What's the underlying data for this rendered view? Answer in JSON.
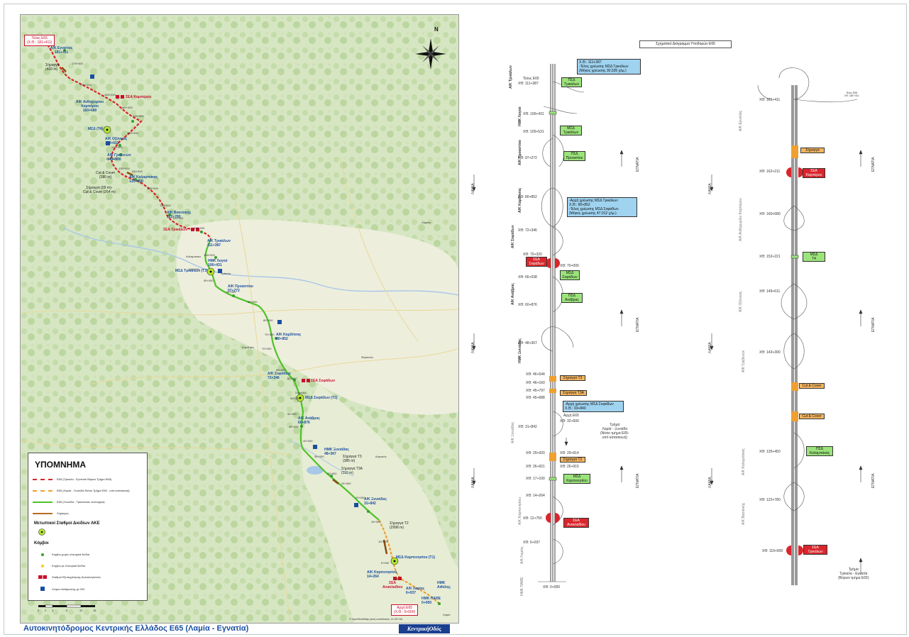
{
  "title": "Αυτοκινητόδρομος Κεντρικής Ελλάδος Ε65 (Λαμία - Εγνατία)",
  "logo_text": "ΚεντρικήΟδός",
  "colors": {
    "accent": "#1a4fa0",
    "brand_red": "#c8102e",
    "route_green": "#4fc22a",
    "route_red": "#d9262c",
    "route_orange": "#f0a030"
  },
  "map": {
    "north_label": "N",
    "attribution": "© OpenStreetMap (and) contributors, CC-BY-SA",
    "scale_labels": [
      "0",
      "2",
      "4",
      "8",
      "12",
      "16"
    ],
    "start_box": [
      "Τέλος Ε65",
      "(Χ.Θ.: 181+411)"
    ],
    "end_box": [
      "Αρχή Ε65",
      "(Χ.Θ.: 0+000)"
    ],
    "labels": {
      "ak_egnatias": [
        "Α/Κ Εγνατίας",
        "181+411"
      ],
      "tunnel_400": [
        "Σήραγγα",
        "(400 m)"
      ],
      "sea_karpirou": "ΣΕΑ Καρπέρου",
      "ak_anthochoriou": [
        "Α/Κ Ανθοχωρίου",
        "Καρπέρου",
        "160+680"
      ],
      "msd_t4": "ΜΣΔ (Τ4)",
      "ak_oxyneias": [
        "Α/Κ Οξύνειας",
        "149+611"
      ],
      "ak_grevenon": [
        "Α/Κ Γρεβενών",
        "143+390"
      ],
      "cut_cover_180": [
        "Cut & Cover",
        "(180 m)"
      ],
      "ak_kalampakas": [
        "Α/Κ Καλαμπάκας",
        "135+450"
      ],
      "tunnel_65": [
        "Σήραγγα (65 m)-",
        "Cut & Cover (264 m)"
      ],
      "ak_vasilikis": [
        "Α/Κ Βασιλικής",
        "122+780"
      ],
      "sea_trikalon": "ΣΕΑ Τρικάλων",
      "ak_trikalon": [
        "Α/Κ Τρικάλων",
        "111+387"
      ],
      "ihk_lygou": [
        "ΗΜΚ Λυγού",
        "106+431"
      ],
      "msd_trikalon": "ΜΣΔ Τρικάλων (Τ3)",
      "ak_prodromou": [
        "Α/Κ Προαστίου",
        "97+272"
      ],
      "ak_karditsas": [
        "Α/Κ Καρδίτσας",
        "80+852"
      ],
      "ak_sofadon": [
        "Α/Κ Σοφάδων",
        "72+346"
      ],
      "sea_sofadon": "ΣΕΑ Σοφάδων",
      "msd_sofadon": "ΜΣΔ Σοφάδων (Τ2)",
      "ak_anavras": [
        "Α/Κ Ανάβρας",
        "60+876"
      ],
      "ihk_xyniadas": [
        "ΗΜΚ Ξυνιάδας",
        "48+367"
      ],
      "tunnel_t3": [
        "Σήραγγα Τ3",
        "(385 m)"
      ],
      "tunnel_t3a": [
        "Σήραγγα Τ3Α",
        "(110 m)"
      ],
      "ak_xyniadas": [
        "Α/Κ Ξυνιάδας",
        "31+842"
      ],
      "tunnel_t2": [
        "Σήραγγα Τ2",
        "(2998 m)"
      ],
      "msd_karpenision": "ΜΣΔ Καρπενησίου (Τ1)",
      "ak_karpenision": [
        "Α/Κ Καρπενησίου",
        "14+264"
      ],
      "sea_anakladiou": [
        "ΣΕΑ",
        "Ανακλαδίου"
      ],
      "ak_lamias": [
        "Α/Κ Λαμίας",
        "6+037"
      ],
      "ihk_avythos": [
        "ΗΜΚ",
        "Αιθύλης"
      ],
      "ihk_pathe": [
        "ΗΜΚ ΠΑΘΕ",
        "0+000"
      ]
    },
    "km_ticks": [
      "175+000",
      "170+000",
      "165+000",
      "160+000",
      "155+000",
      "150+000",
      "145+000",
      "140+000",
      "135+000",
      "130+000",
      "125+000",
      "120+000",
      "115+000",
      "110+000",
      "105+000",
      "100+000",
      "95+000",
      "90+000",
      "85+000",
      "80+000",
      "75+000",
      "70+000",
      "65+000",
      "60+000",
      "55+000",
      "50+000",
      "45+000",
      "40+000",
      "35+000",
      "30+000",
      "25+000",
      "20+000",
      "15+000",
      "10+000",
      "5+000"
    ],
    "towns": [
      "Καλαμπάκα",
      "Τρίκαλα",
      "Καρδίτσα",
      "Σοφάδες",
      "Φάρσαλα",
      "Λάρισα",
      "Δομοκός",
      "Λαμία"
    ]
  },
  "legend": {
    "title": "ΥΠΟΜΝΗΜΑ",
    "items": [
      "Ε65 (Τρίκαλα - Εγνατία/ Βόρειο Τμήμα Ε65)",
      "Ε65 (Λαμία - Ξυνιάδα /Νότιο Τμήμα Ε65 - υπό κατασκευή)",
      "Ε65 (Ξυνιάδα - Τρίκαλα/σε λειτουργία)",
      "Σήραγγες"
    ],
    "toll_header": "Μετωπικοί Σταθμοί Διοδίων ΑΚΕ",
    "nodes_header": "Κόμβοι",
    "node_items": [
      "Κόμβοι χωρίς πλευρικά διόδια",
      "Κόμβοι με πλευρικά διόδια",
      "Σταθμοί Εξυπηρέτησης Αυτοκινητιστών",
      "Χώροι στάθμευσης με WC"
    ]
  },
  "diagram": {
    "title": "Σχηματικό Διάγραμμα Υποδομών Ε65",
    "left_col": {
      "side_labels": [
        "Α/Κ Τρικάλων",
        "ΗΜΚ Λυγού",
        "Α/Κ Προαστίου",
        "Α/Κ Καρδίτσας",
        "Α/Κ Σοφάδων",
        "Α/Κ Ανάβρας",
        "ΗΜΚ Ξυνιάδας"
      ],
      "side_labels_grey": [
        "Α/Κ Ξυνιάδας",
        "Α/Κ Καρπενησίου",
        "Α/Κ Λαμίας",
        "ΗΜΚ ΠΑΘΕ"
      ],
      "chainages": [
        "Τέλος Ε65",
        "ΧΘ: 111+387",
        "ΧΘ: 106+431",
        "ΧΘ: 105+531",
        "ΧΘ: 97+272",
        "ΧΘ: 80+852",
        "ΧΘ: 72+346",
        "ΧΘ: 70+320",
        "ΧΘ: 70+000",
        "ΧΘ: 66+038",
        "ΧΘ: 60+876",
        "ΧΘ: 48+367",
        "ΧΘ: 46+544",
        "ΧΘ: 46+160",
        "ΧΘ: 45+797",
        "ΧΘ: 45+688",
        "ΧΘ: 31+842",
        "ΧΘ: 29+920",
        "ΧΘ: 29+914",
        "ΧΘ: 26+921",
        "ΧΘ: 26+915",
        "ΧΘ: 17+100",
        "ΧΘ: 14+264",
        "ΧΘ: 12+750",
        "ΧΘ: 6+037",
        "ΧΘ: 0+000",
        "Αρχή Ε65",
        "ΧΘ: 32+500"
      ],
      "info_top": [
        "Χ.Θ.: 111+387",
        "-Τέλος χρέωσης ΜΣΔ Τρικάλων",
        "(Μήκος χρέωσης 30,535 χλμ.)"
      ],
      "info_mid": [
        "-Αρχή χρέωσης ΜΣΔ Τρικάλων",
        "Χ.Θ.: 80+852",
        "-Τέλος χρέωσης ΜΣΔ Σοφάδων",
        "(Μήκος χρέωσης 47,012 χλμ.)"
      ],
      "info_low": [
        "-Αρχή χρέωσης ΜΣΔ Σοφάδων",
        "Χ.Θ.: 33+840"
      ],
      "tags": {
        "pesd_trikalon": [
          "ΠΣΔ",
          "Τρικάλων"
        ],
        "msd_trikalon": [
          "ΜΣΔ",
          "Τρικάλων"
        ],
        "pesd_proastiou": [
          "ΠΣΔ",
          "Προαστίου"
        ],
        "sea_sofadon": [
          "ΣΕΑ",
          "Σοφάδων"
        ],
        "msd_sofadon": [
          "ΜΣΔ",
          "Σοφάδων"
        ],
        "pesd_anavras": [
          "ΠΣΔ",
          "Ανάβρας"
        ],
        "tunnel_t3": "Σήραγγα Τ3",
        "tunnel_t3a": "Σήραγγα Τ3Α",
        "tunnel_t2": "Σήραγγα Τ2",
        "msd_karpenisiou": [
          "ΜΣΔ",
          "Καρπενησίου"
        ],
        "sea_anakladiou": [
          "ΣΕΑ",
          "Ανακλαδίου"
        ]
      },
      "section_note": [
        "Τμήμα",
        "Λαμία - Ξυνιάδα",
        "(Νότιο τμήμα Ε65-",
        "υπό κατασκευή)"
      ],
      "dir_left": "ΛΑΜΙΑ",
      "dir_right": "ΕΓΝΑΤΙΑ"
    },
    "right_col": {
      "side_labels": [
        "Α/Κ Εγνατίας",
        "Α/Κ Ανθοχωρίου Καρπέρου",
        "Α/Κ Οξύνειας",
        "Α/Κ Γρεβενών",
        "Α/Κ Καλαμπάκας",
        "Α/Κ Βασιλικής"
      ],
      "chainages": [
        "ΧΘ: 181+411",
        "ΧΘ: 162+211",
        "ΧΘ: 160+680",
        "ΧΘ: 152+221",
        "ΧΘ: 149+611",
        "ΧΘ: 143+390",
        "ΧΘ: 135+450",
        "ΧΘ: 122+780",
        "ΧΘ: 116+600"
      ],
      "top_note": [
        "Τέλος Ε65",
        "ΧΘ: 181+411"
      ],
      "tags": {
        "tunnel": "Σήραγγα",
        "sea_karperou": [
          "ΣΕΑ",
          "Καρπέρου"
        ],
        "msd_t4": [
          "ΜΣΔ",
          "Τ4"
        ],
        "cut_cover": "Cut & Cover",
        "pesd_kalampakas": [
          "ΠΣΔ",
          "Καλαμπάκας"
        ],
        "sea_trikalon": [
          "ΣΕΑ",
          "Τρικάλων"
        ]
      },
      "section_note": [
        "Τμήμα",
        "Τρίκαλα - Εγνατία",
        "(Βόρειο τμήμα Ε65)"
      ],
      "dir_left": "ΛΑΜΙΑ",
      "dir_right": "ΕΓΝΑΤΙΑ"
    }
  }
}
